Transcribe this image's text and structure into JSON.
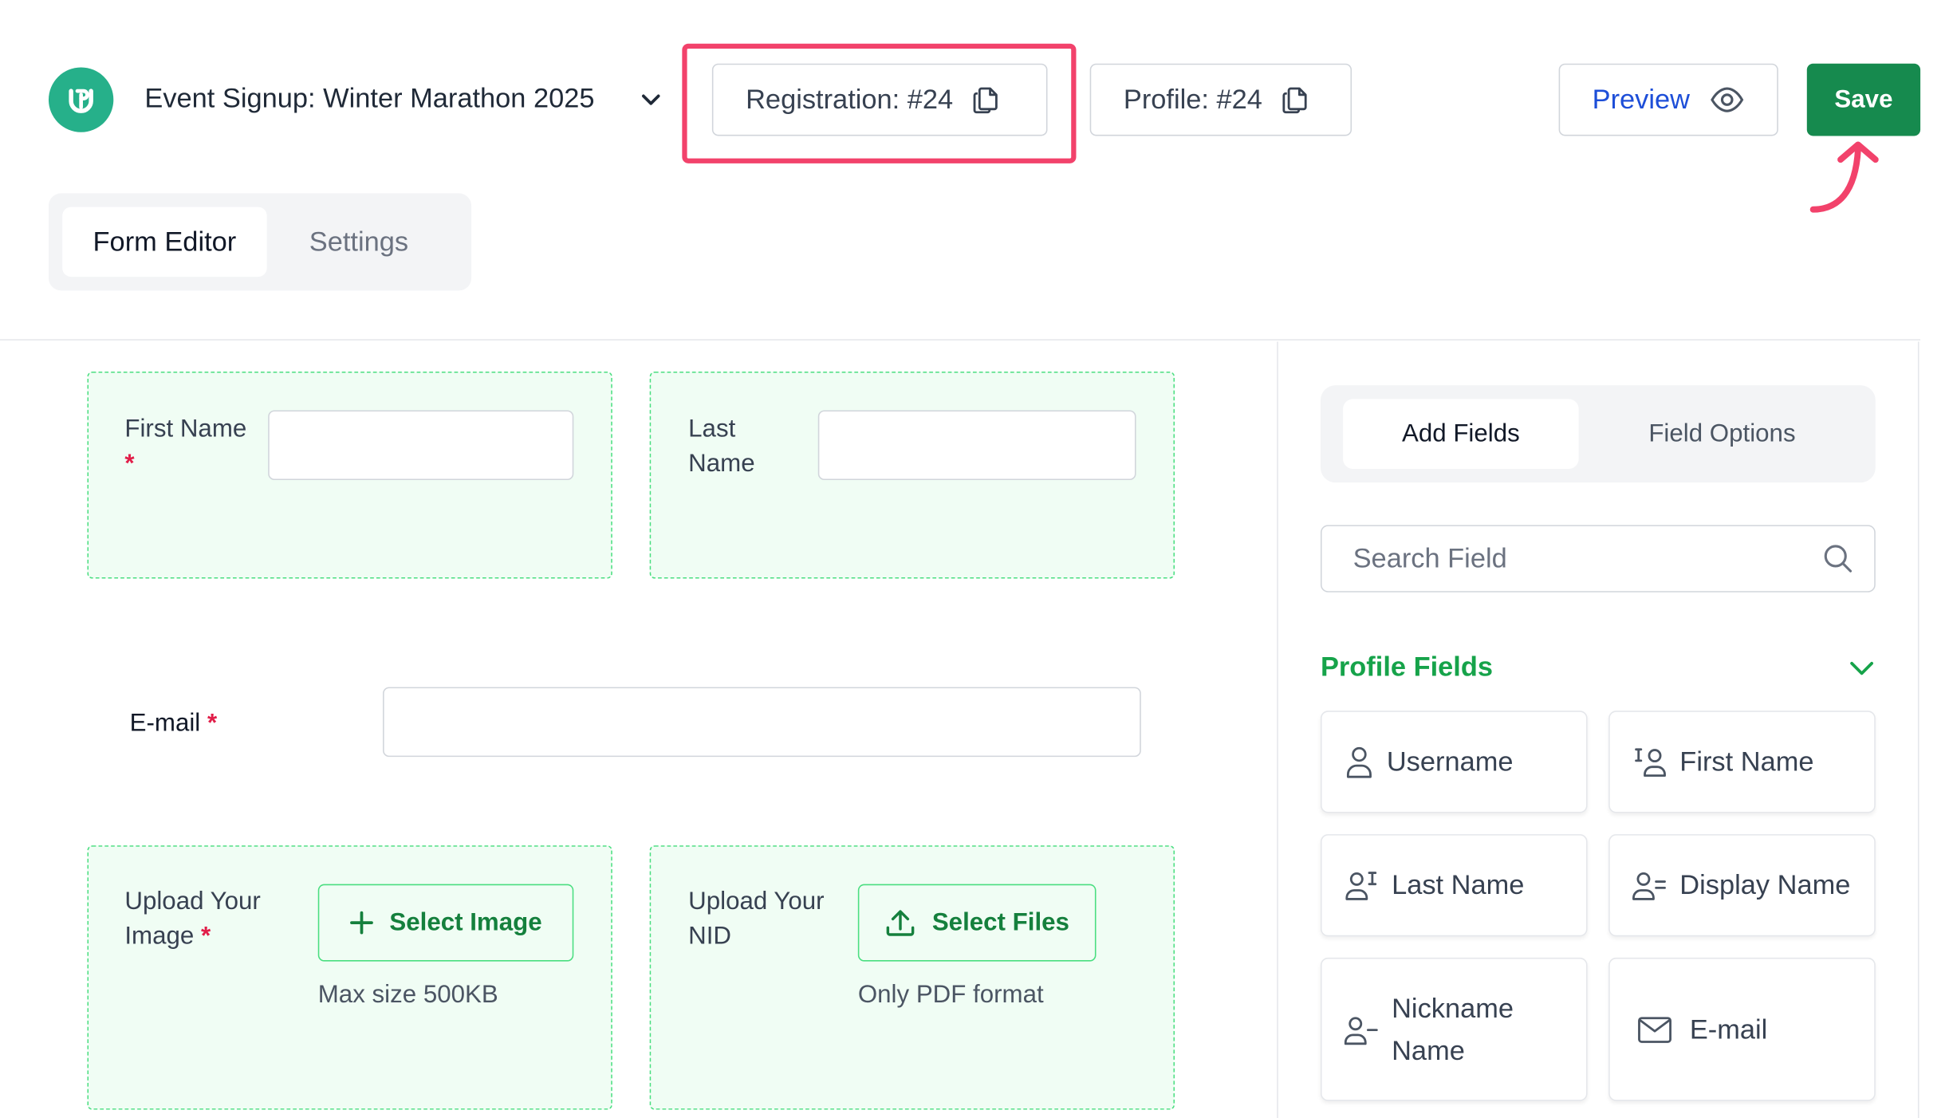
{
  "header": {
    "form_title": "Event Signup: Winter Marathon 2025",
    "registration_label": "Registration: #24",
    "profile_label": "Profile: #24",
    "preview_label": "Preview",
    "save_label": "Save"
  },
  "tabs": {
    "form_editor": "Form Editor",
    "settings": "Settings"
  },
  "form": {
    "first_name_label": "First Name",
    "first_name_required": "*",
    "last_name_label": "Last\nName",
    "email_label": "E-mail",
    "email_required": "*",
    "upload_image_label": "Upload Your\nImage",
    "upload_image_required": "*",
    "select_image_label": "Select Image",
    "image_hint": "Max size 500KB",
    "upload_nid_label": "Upload Your\nNID",
    "select_files_label": "Select Files",
    "nid_hint": "Only PDF format"
  },
  "panel": {
    "tab_add_fields": "Add Fields",
    "tab_field_options": "Field Options",
    "search_placeholder": "Search Field",
    "section_title": "Profile Fields",
    "fields": [
      {
        "label": "Username",
        "icon": "user-icon"
      },
      {
        "label": "First Name",
        "icon": "first-name-icon"
      },
      {
        "label": "Last Name",
        "icon": "last-name-icon"
      },
      {
        "label": "Display Name",
        "icon": "display-name-icon"
      },
      {
        "label": "Nickname\nName",
        "icon": "nickname-icon"
      },
      {
        "label": "E-mail",
        "icon": "envelope-icon"
      }
    ]
  },
  "colors": {
    "brand": "#26b08a",
    "save": "#168a4e",
    "highlight": "#f2426b",
    "section": "#16a34a",
    "preview_text": "#1d4ed8"
  }
}
